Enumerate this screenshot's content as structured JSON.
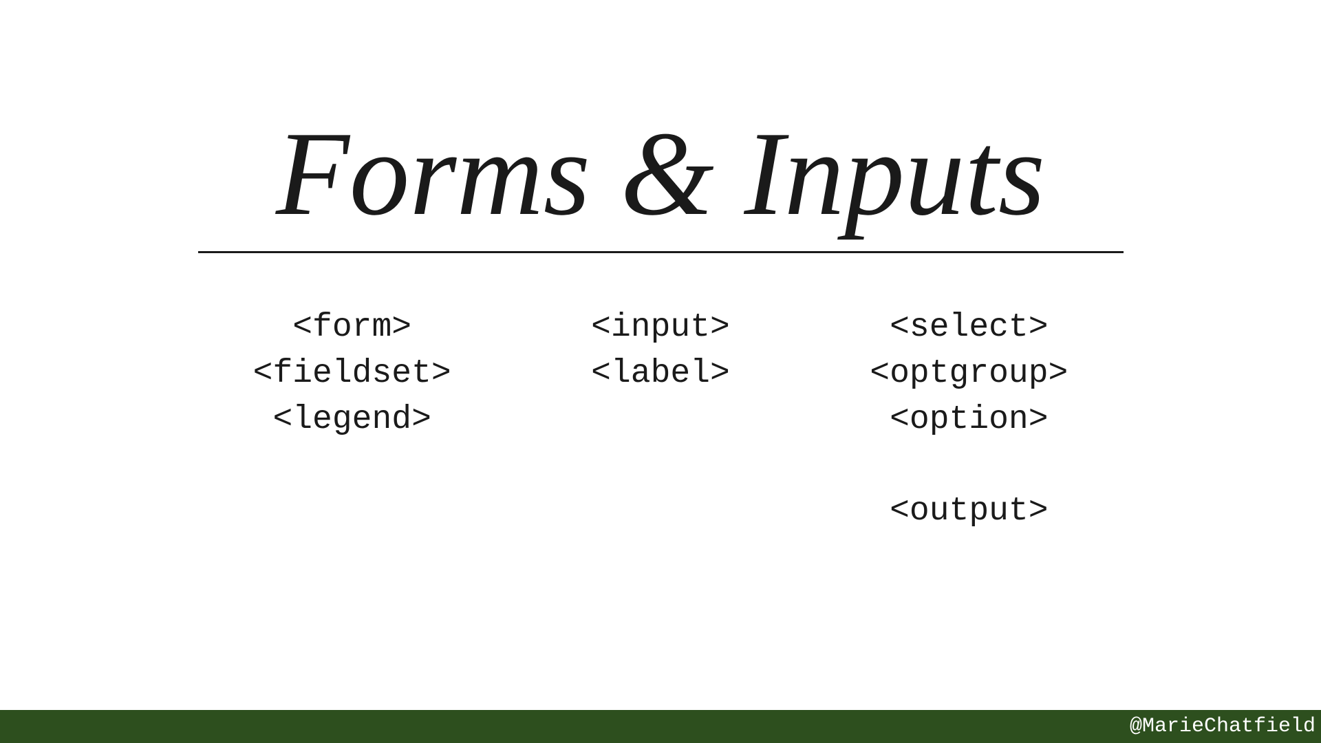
{
  "slide": {
    "title": "Forms & Inputs",
    "columns": [
      {
        "items": [
          "<form>",
          "<fieldset>",
          "<legend>"
        ]
      },
      {
        "items": [
          "<input>",
          "<label>"
        ]
      },
      {
        "items": [
          "<select>",
          "<optgroup>",
          "<option>",
          "",
          "<output>"
        ]
      }
    ]
  },
  "footer": {
    "handle": "@MarieChatfield"
  }
}
